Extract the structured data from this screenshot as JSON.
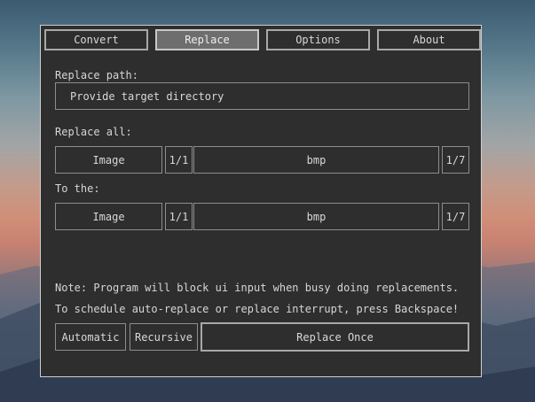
{
  "tabs": [
    {
      "label": "Convert",
      "active": false
    },
    {
      "label": "Replace",
      "active": true
    },
    {
      "label": "Options",
      "active": false
    },
    {
      "label": "About",
      "active": false
    }
  ],
  "replace_path": {
    "label": "Replace path:",
    "value": "Provide target directory"
  },
  "replace_all": {
    "label": "Replace all:",
    "type": "Image",
    "index": "1/1",
    "format": "bmp",
    "count": "1/7"
  },
  "to_the": {
    "label": "To the:",
    "type": "Image",
    "index": "1/1",
    "format": "bmp",
    "count": "1/7"
  },
  "notes": {
    "line1": "Note: Program will block ui input when busy doing replacements.",
    "line2": "To schedule auto-replace or replace interrupt, press Backspace!"
  },
  "actions": {
    "automatic": "Automatic",
    "recursive": "Recursive",
    "replace_once": "Replace Once"
  },
  "colors": {
    "panel": "#2e2e2e",
    "border": "#8d8d8d",
    "text": "#d8d8d8",
    "active_tab": "#6e6e6e"
  }
}
